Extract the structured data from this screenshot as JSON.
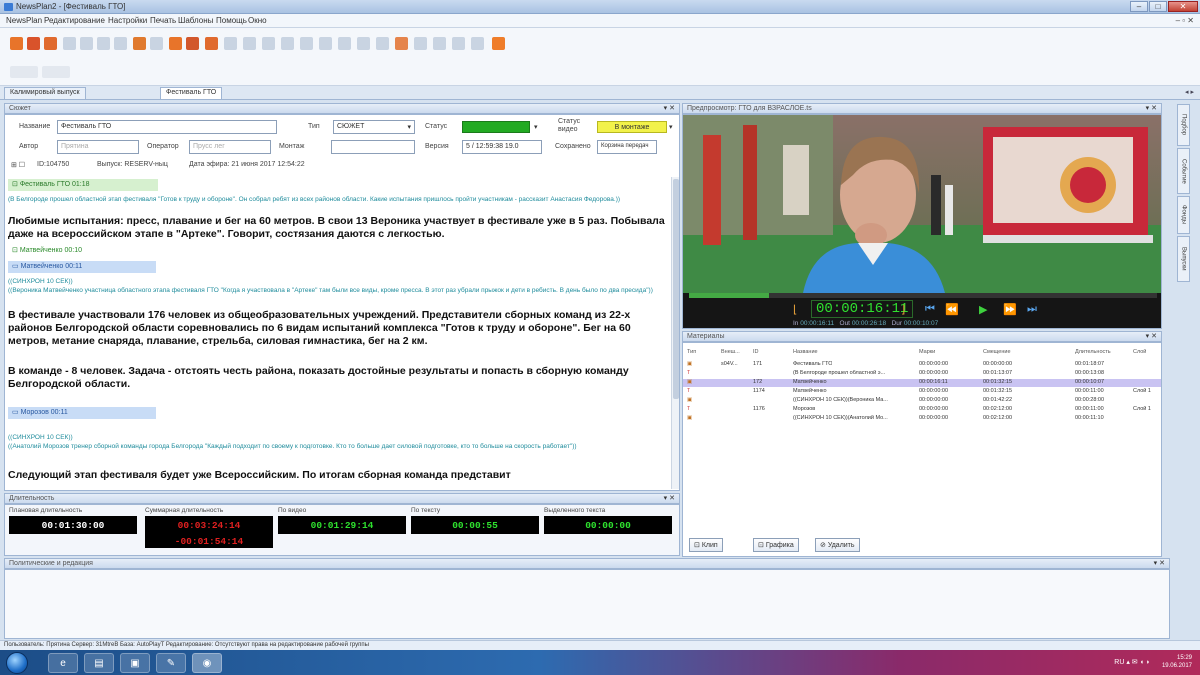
{
  "window": {
    "title": "NewsPlan2 - [Фестиваль ГТО]"
  },
  "menu": [
    "NewsPlan",
    "Редактирование",
    "Настройки",
    "Печать",
    "Шаблоны",
    "Помощь",
    "Окно"
  ],
  "doc_tabs": [
    "Калимировый выпуск",
    "Фестиваль ГТО"
  ],
  "doc_tabs_nav": "◂ ▸",
  "left_panel": {
    "header": "Сюжет",
    "controls": "▾ ✕"
  },
  "form": {
    "name_label": "Название",
    "name_value": "Фестиваль ГТО",
    "type_label": "Тип",
    "type_value": "СЮЖЕТ",
    "status_label": "Статус",
    "status2_label": "Статус видео",
    "status2_value": "В монтаже",
    "author_label": "Автор",
    "author_value": "Прятина",
    "operator_label": "Оператор",
    "operator_value": "Прусс лег",
    "montage_label": "Монтаж",
    "version_label": "Версия",
    "version_value": "5 / 12:59:38 19.0",
    "saved_label": "Сохранено",
    "saved_value": "Корзина передач",
    "info_id": "ID:104750",
    "info_block": "Выпуск: RESERV-ныц",
    "info_date": "Дата эфира: 21 июня 2017 12:54:22"
  },
  "story": {
    "seg1_title": "Фестиваль ГТО   01:18",
    "seg1_sync": "(В Белгороде прошел областной этап фестиваля \"Готов к труду и обороне\". Он собрал ребят из всех районов области. Какие испытания пришлось пройти участникам - рассказит Анастасия Федорова.))",
    "bold1": "Любимые испытания: пресс, плавание и бег на 60 метров. В свои 13 Вероника участвует в фестивале уже в 5 раз.  Побывала даже на всероссийском этапе в \"Артеке\". Говорит, состязания даются с легкостью.",
    "seg2_title": "Матвейченко   00:10",
    "seg3_title": "Матвейченко   00:11",
    "seg3_sync": "((СИНХРОН 10 СЕК))\n((Вероника Матвейченко участница областного этапа фестиваля ГТО \"Когда я участвовала в \"Артеке\" там были все виды, кроме пресса. В этот раз убрали прыжок и дети в ребисть. В день было по два пресида\"))",
    "bold2": "В фестивале участвовали 176 человек из общеобразовательных учреждений. Представители сборных команд из 22-х районов Белгородской области соревновались по 6 видам испытаний комплекса \"Готов к труду и обороне\". Бег на 60 метров, метание снаряда, плавание, стрельба, силовая гимнастика, бег на 2 км.",
    "bold3": "В команде - 8 человек. Задача - отстоять честь района, показать достойные результаты и попасть в сборную команду Белгородской области.",
    "seg4_title": "Морозов   00:11",
    "seg4_sync": "((СИНХРОН 10 СЕК))\n((Анатолий Морозов тренер сборной команды города Белгорода \"Каждый подходит по своему к подготовке. Кто то больше дает силовой подготовке, кто то больше на скорость работает\"))",
    "bold4": "Следующий этап фестиваля будет уже Всероссийским. По итогам сборная команда представит"
  },
  "duration_panel": {
    "header": "Длительность",
    "controls": "▾ ✕",
    "cols": [
      {
        "label": "Плановая длительность",
        "value": "00:01:30:00",
        "color": "#ffffff"
      },
      {
        "label": "Суммарная длительность",
        "value": "00:03:24:14",
        "value2": "-00:01:54:14",
        "color": "#e02020"
      },
      {
        "label": "По видео",
        "value": "00:01:29:14",
        "color": "#2ee02e"
      },
      {
        "label": "По тексту",
        "value": "00:00:55",
        "color": "#2ee02e"
      },
      {
        "label": "Выделенного текста",
        "value": "00:00:00",
        "color": "#2ee02e"
      }
    ]
  },
  "preview": {
    "header": "Предпросмотр: ГТО для ВЗРАСЛОЕ.ts",
    "controls": "▾ ✕",
    "timecode": "00:00:16:11",
    "in_label": "In",
    "in_value": "00:00:16:11",
    "out_label": "Out",
    "out_value": "00:00:26:18",
    "dur_label": "Dur",
    "dur_value": "00:00:10:07",
    "progress": 0.17
  },
  "materials": {
    "header": "Материалы",
    "controls": "▾ ✕",
    "columns": [
      "Тип",
      "Внеш...",
      "ID",
      "Название",
      "Марки",
      "Смещение",
      "",
      "Длительность",
      "Слой"
    ],
    "rows": [
      {
        "id": "171",
        "code": "s04V...",
        "name": "Фестиваль ГТО",
        "mark": "00:00:00:00",
        "offset": "00:00:00:00",
        "dur": "00:01:18:07",
        "layer": "",
        "selected": false
      },
      {
        "id": "",
        "code": "",
        "name": "(В Белгороде прошел областной э...",
        "mark": "00:00:00:00",
        "offset": "00:01:13:07",
        "dur": "00:00:13:08",
        "layer": "",
        "selected": false
      },
      {
        "id": "172",
        "code": "",
        "name": "Матвейченко",
        "mark": "00:00:16:11",
        "offset": "00:01:32:15",
        "dur": "00:00:10:07",
        "layer": "",
        "selected": true
      },
      {
        "id": "1174",
        "code": "",
        "name": "Матвейченко",
        "mark": "00:00:00:00",
        "offset": "00:01:32:15",
        "dur": "00:00:11:00",
        "layer": "Слой 1",
        "selected": false
      },
      {
        "id": "",
        "code": "",
        "name": "((СИНХРОН 10 СЕК))(Вероника Ма...",
        "mark": "00:00:00:00",
        "offset": "00:01:42:22",
        "dur": "00:00:28:00",
        "layer": "",
        "selected": false
      },
      {
        "id": "1176",
        "code": "",
        "name": "Морозов",
        "mark": "00:00:00:00",
        "offset": "00:02:12:00",
        "dur": "00:00:11:00",
        "layer": "Слой 1",
        "selected": false
      },
      {
        "id": "",
        "code": "",
        "name": "((СИНХРОН 10 СЕК))(Анатолий Мо...",
        "mark": "00:00:00:00",
        "offset": "00:02:12:00",
        "dur": "00:00:11:10",
        "layer": "",
        "selected": false
      }
    ],
    "btn_clip": "Клип",
    "btn_graphics": "Графика",
    "btn_delete": "Удалить"
  },
  "side_tabs": [
    "Подбор",
    "Событие",
    "Фонды",
    "Выпуски"
  ],
  "bottom_panel": {
    "header": "Политические и редакция",
    "controls": "▾ ✕"
  },
  "statusbar": "Пользователь: Прятина   Сервер: 31MtreB   База: AutoPlayT   Редактирование:   Отсутствуют права на редактирование рабочей группы",
  "taskbar": {
    "time": "15:29",
    "date": "19.06.2017",
    "tray": "RU ▴ ✉ ◖ ◗"
  }
}
